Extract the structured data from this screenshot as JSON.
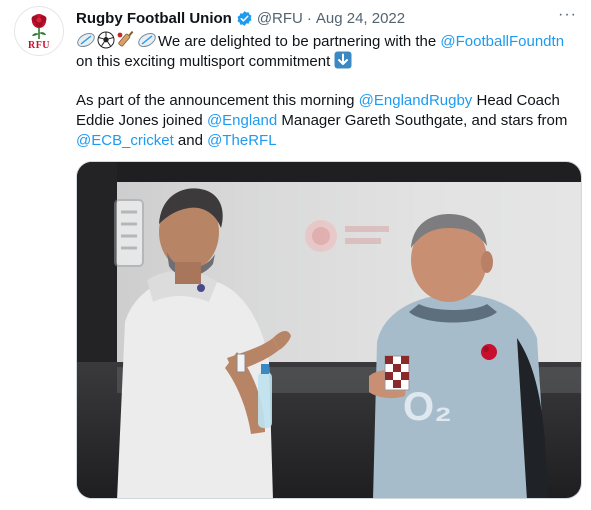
{
  "tweet": {
    "author_name": "Rugby Football Union",
    "handle": "@RFU",
    "separator": "·",
    "date": "Aug 24, 2022",
    "more_label": "···",
    "avatar_text": "RFU",
    "text": {
      "l1_text": "We are delighted to be partnering with the ",
      "l1_mention": "@FootballFoundtn",
      "l2_text": "on this exciting multisport commitment",
      "l3_text": "As part of the announcement this morning ",
      "l3_mention": "@EnglandRugby",
      "l3_tail": " Head Coach",
      "l4_text": "Eddie Jones joined ",
      "l4_mention": "@England",
      "l4_tail": " Manager Gareth Southgate, and stars from",
      "l5_mention1": "@ECB_cricket",
      "l5_mid": " and ",
      "l5_mention2": "@TheRFL"
    },
    "emoji_icons": [
      "rugby-ball-icon",
      "soccer-ball-icon",
      "cricket-bat-icon",
      "rugby-ball-icon",
      "down-arrow-icon"
    ],
    "photo": {
      "shirt_text": "O₂"
    }
  },
  "colors": {
    "link": "#1d9bf0",
    "verified": "#1d9bf0",
    "muted": "#536471",
    "rfu_red": "#c8102e"
  }
}
